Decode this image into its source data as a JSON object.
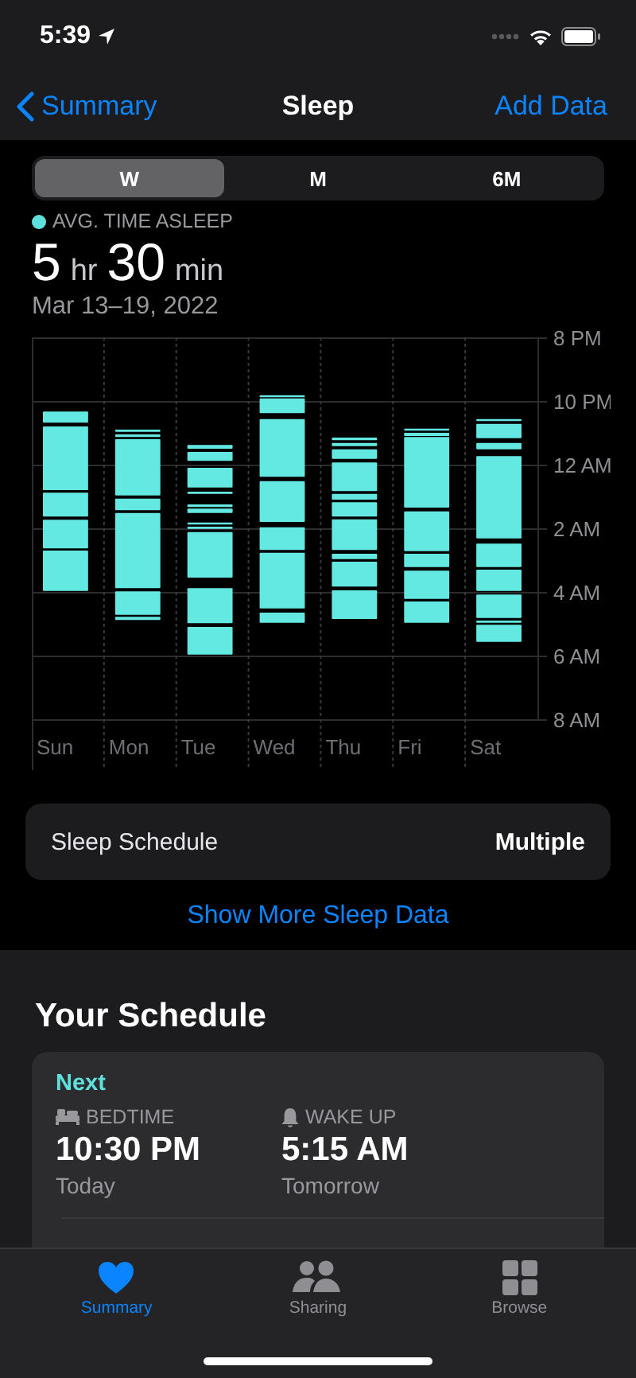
{
  "status_bar": {
    "time": "5:39"
  },
  "nav": {
    "back": "Summary",
    "title": "Sleep",
    "action": "Add Data"
  },
  "range_tabs": [
    {
      "label": "W",
      "selected": true
    },
    {
      "label": "M",
      "selected": false
    },
    {
      "label": "6M",
      "selected": false
    }
  ],
  "summary": {
    "legend": "AVG. TIME ASLEEP",
    "value_parts": [
      {
        "number": "5",
        "unit": "hr"
      },
      {
        "number": "30",
        "unit": "min"
      }
    ],
    "date_range": "Mar 13–19, 2022"
  },
  "sleep_chart": {
    "kind": "picture",
    "days": [
      "Sun",
      "Mon",
      "Tue",
      "Wed",
      "Thu",
      "Fri",
      "Sat"
    ],
    "hour_labels": [
      "8 PM",
      "10 PM",
      "12 AM",
      "2 AM",
      "4 AM",
      "6 AM",
      "8 AM"
    ]
  },
  "schedule_row": {
    "label": "Sleep Schedule",
    "value": "Multiple"
  },
  "more_link": "Show More Sleep Data",
  "your_schedule": {
    "title": "Your Schedule",
    "next_label": "Next",
    "items": [
      {
        "kind": "bed",
        "label": "BEDTIME",
        "time": "10:30 PM",
        "day": "Today"
      },
      {
        "kind": "alarm",
        "label": "WAKE UP",
        "time": "5:15 AM",
        "day": "Tomorrow"
      }
    ]
  },
  "tab_bar": [
    {
      "label": "Summary",
      "selected": true
    },
    {
      "label": "Sharing",
      "selected": false
    },
    {
      "label": "Browse",
      "selected": false
    }
  ]
}
